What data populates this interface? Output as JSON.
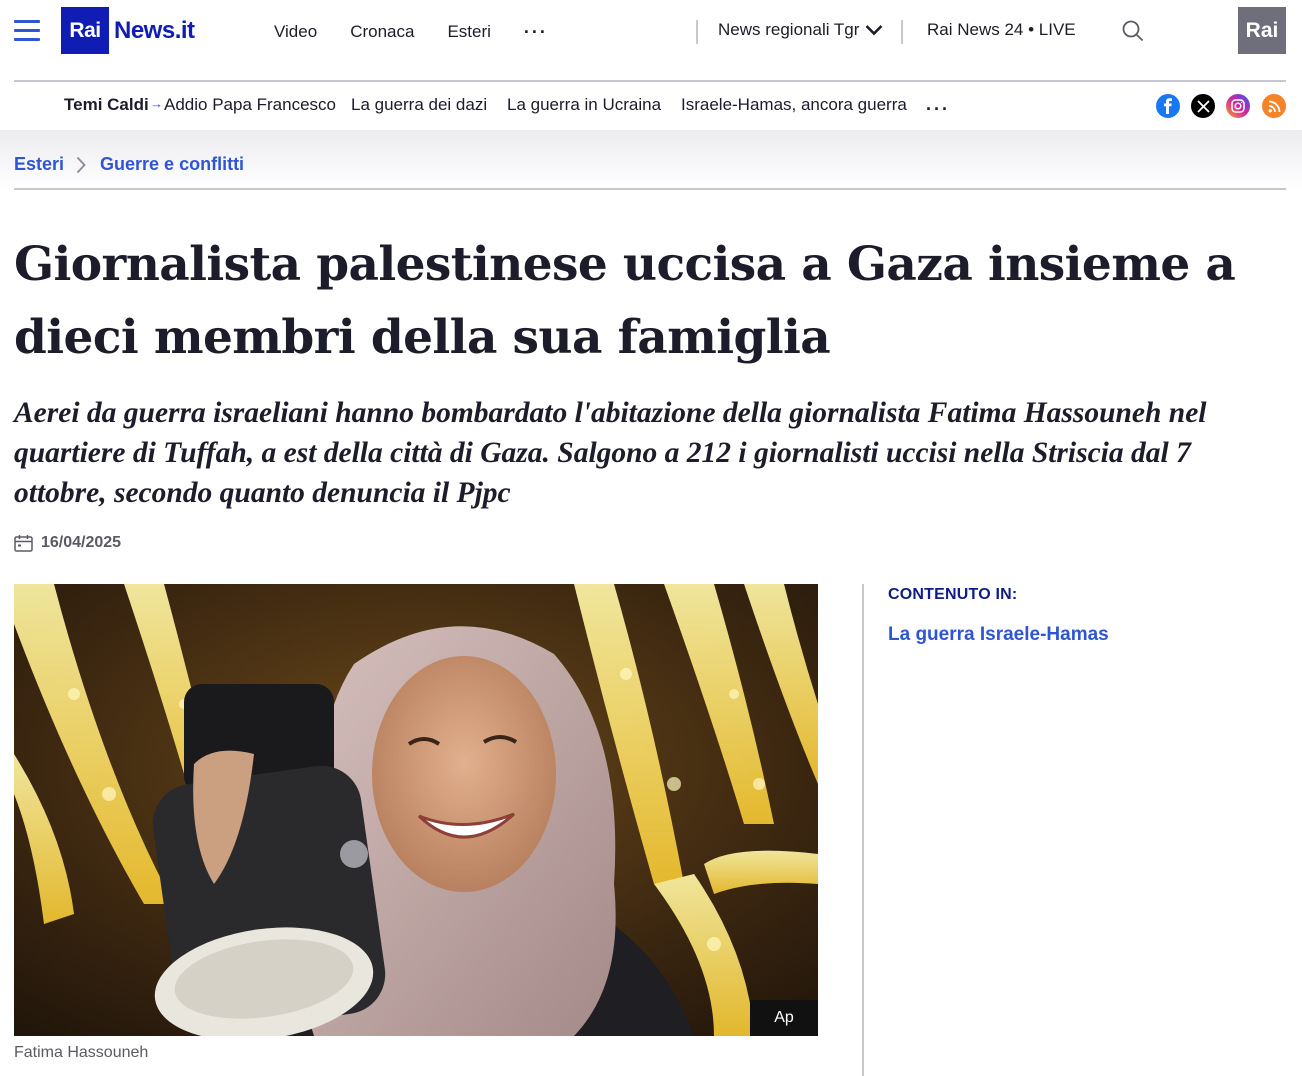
{
  "header": {
    "logo_rai": "Rai",
    "logo_news": "News.it",
    "nav": [
      "Video",
      "Cronaca",
      "Esteri"
    ],
    "more": "···",
    "regionali": "News regionali Tgr",
    "live": "Rai News 24 • LIVE",
    "rai_corner": "Rai"
  },
  "topics": {
    "label": "Temi Caldi",
    "items": [
      "Addio Papa Francesco",
      "La guerra dei dazi",
      "La guerra in Ucraina",
      "Israele-Hamas, ancora guerra"
    ],
    "more": "···",
    "social": [
      "facebook-icon",
      "x-icon",
      "instagram-icon",
      "rss-icon"
    ]
  },
  "breadcrumb": {
    "items": [
      "Esteri",
      "Guerre e conflitti"
    ]
  },
  "article": {
    "headline": "Giornalista palestinese uccisa a Gaza insieme a dieci membri della sua famiglia",
    "subtitle": "Aerei da guerra israeliani hanno bombardato l'abitazione della giornalista Fatima Hassouneh nel quartiere di Tuffah, a est della città di Gaza. Salgono a 212 i giornalisti uccisi nella Striscia dal 7 ottobre, secondo quanto denuncia il Pjpc",
    "date": "16/04/2025",
    "image_credit": "Ap",
    "caption": "Fatima Hassouneh"
  },
  "sidebar": {
    "label": "CONTENUTO IN:",
    "link": "La guerra Israele-Hamas"
  },
  "colors": {
    "brand_blue": "#0f1db5",
    "link_blue": "#2f55d4",
    "text": "#1c1c2b",
    "muted": "#5a5a66",
    "facebook": "#1877f2",
    "x": "#000000",
    "instagram": "#c13584",
    "rss": "#f5832a"
  }
}
